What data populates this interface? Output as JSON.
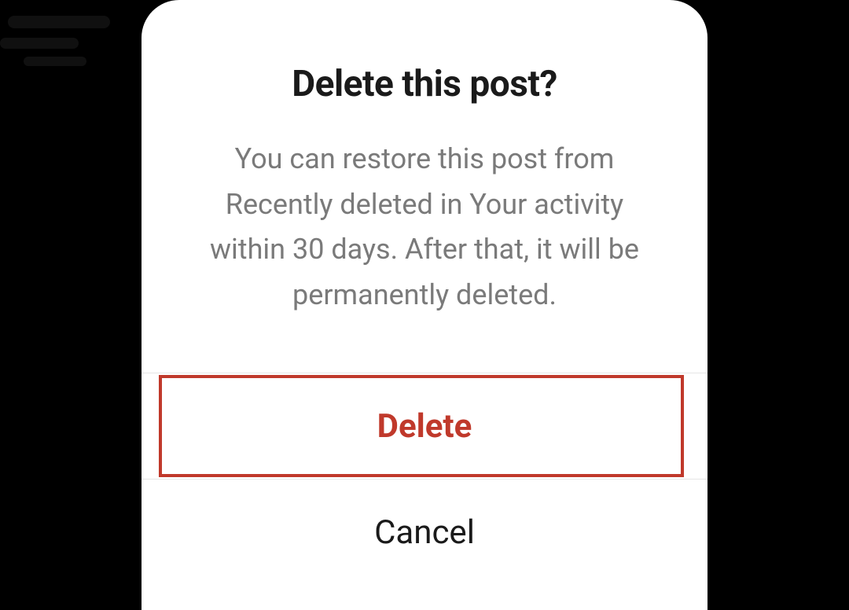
{
  "modal": {
    "title": "Delete this post?",
    "description": "You can restore this post from Recently deleted in Your activ­ity within 30 days. After that, it will be permanently deleted.",
    "actions": {
      "delete_label": "Delete",
      "cancel_label": "Cancel"
    },
    "colors": {
      "destructive": "#c0392b",
      "text_primary": "#1a1a1a",
      "text_secondary": "#7a7a7a",
      "divider": "#e6e6e6"
    }
  }
}
